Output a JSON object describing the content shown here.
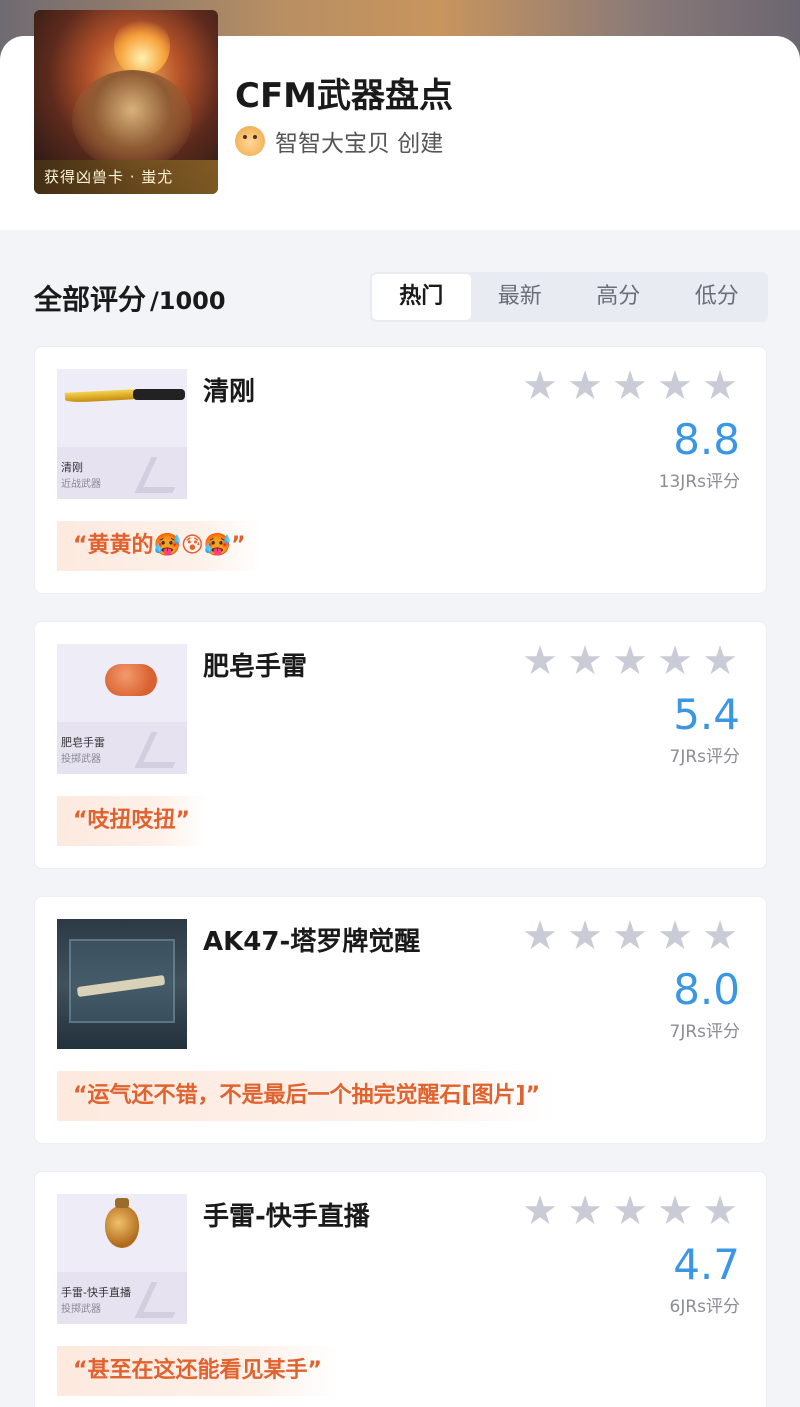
{
  "header": {
    "cover_caption": "获得凶兽卡 · 蚩尤",
    "title": "CFM武器盘点",
    "creator": "智智大宝贝 创建"
  },
  "section": {
    "title": "全部评分",
    "max_score": "/1000"
  },
  "tabs": [
    {
      "label": "热门",
      "active": true
    },
    {
      "label": "最新",
      "active": false
    },
    {
      "label": "高分",
      "active": false
    },
    {
      "label": "低分",
      "active": false
    }
  ],
  "items": [
    {
      "name": "清刚",
      "thumb_label": "清刚",
      "thumb_category": "近战武器",
      "score": "8.8",
      "rating_count": "13JRs评分",
      "quote": "“黄黄的🥵😰🥵”"
    },
    {
      "name": "肥皂手雷",
      "thumb_label": "肥皂手雷",
      "thumb_category": "投掷武器",
      "score": "5.4",
      "rating_count": "7JRs评分",
      "quote": "“吱扭吱扭”"
    },
    {
      "name": "AK47-塔罗牌觉醒",
      "thumb_label": "",
      "thumb_category": "",
      "score": "8.0",
      "rating_count": "7JRs评分",
      "quote": "“运气还不错，不是最后一个抽完觉醒石[图片]”"
    },
    {
      "name": "手雷-快手直播",
      "thumb_label": "手雷-快手直播",
      "thumb_category": "投掷武器",
      "score": "4.7",
      "rating_count": "6JRs评分",
      "quote": "“甚至在这还能看见某手”"
    }
  ],
  "colors": {
    "score": "#3b97e3",
    "quote_text": "#e0622e",
    "star_empty": "#c9ccd6"
  }
}
